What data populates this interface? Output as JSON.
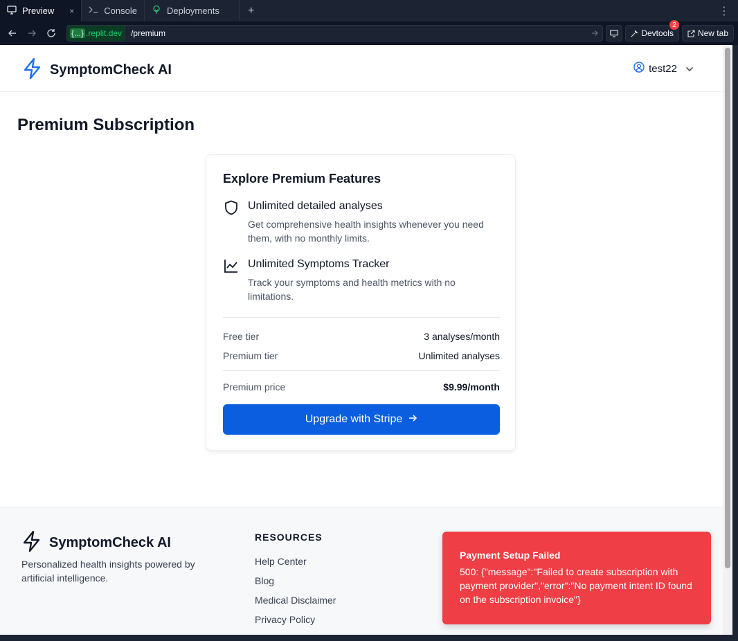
{
  "browser": {
    "tabs": [
      {
        "label": "Preview",
        "icon": "monitor-icon",
        "active": true
      },
      {
        "label": "Console",
        "icon": "terminal-icon",
        "active": false
      },
      {
        "label": "Deployments",
        "icon": "deployments-icon",
        "active": false
      }
    ],
    "close_glyph": "×",
    "add_tab_glyph": "+",
    "more_glyph": "⋮",
    "url_domain_chip": "{...}",
    "url_domain": ".replit.dev",
    "url_path": "/premium",
    "devtools_label": "Devtools",
    "devtools_badge": "2",
    "new_tab_label": "New tab"
  },
  "header": {
    "brand": "SymptomCheck AI",
    "username": "test22",
    "accent_color": "#1f6feb"
  },
  "page": {
    "title": "Premium Subscription"
  },
  "card": {
    "title": "Explore Premium Features",
    "features": [
      {
        "icon": "shield-icon",
        "title": "Unlimited detailed analyses",
        "description": "Get comprehensive health insights whenever you need them, with no monthly limits."
      },
      {
        "icon": "line-chart-icon",
        "title": "Unlimited Symptoms Tracker",
        "description": "Track your symptoms and health metrics with no limitations."
      }
    ],
    "tiers": [
      {
        "label": "Free tier",
        "value": "3 analyses/month"
      },
      {
        "label": "Premium tier",
        "value": "Unlimited analyses"
      }
    ],
    "price": {
      "label": "Premium price",
      "value": "$9.99/month"
    },
    "upgrade_button": "Upgrade with Stripe",
    "button_color": "#0b5ee0"
  },
  "footer": {
    "brand": "SymptomCheck AI",
    "tagline": "Personalized health insights powered by artificial intelligence.",
    "resources_heading": "RESOURCES",
    "resources": [
      "Help Center",
      "Blog",
      "Medical Disclaimer",
      "Privacy Policy"
    ]
  },
  "toast": {
    "title": "Payment Setup Failed",
    "message": "500: {\"message\":\"Failed to create subscription with payment provider\",\"error\":\"No payment intent ID found on the subscription invoice\"}",
    "color": "#ef3e45"
  }
}
